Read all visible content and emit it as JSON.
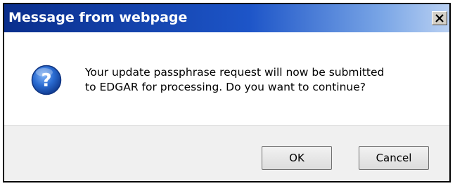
{
  "dialog": {
    "title": "Message from webpage",
    "message_lines": [
      "Your update passphrase request will now be submitted",
      "to EDGAR for processing. Do you want to continue?"
    ],
    "buttons": {
      "ok": "OK",
      "cancel": "Cancel"
    },
    "icons": {
      "question": "question-icon",
      "close": "close-icon"
    },
    "colors": {
      "titlebar_start": "#0a2e8c",
      "titlebar_end": "#b9d0f2",
      "icon_blue": "#2a6bd1"
    }
  }
}
